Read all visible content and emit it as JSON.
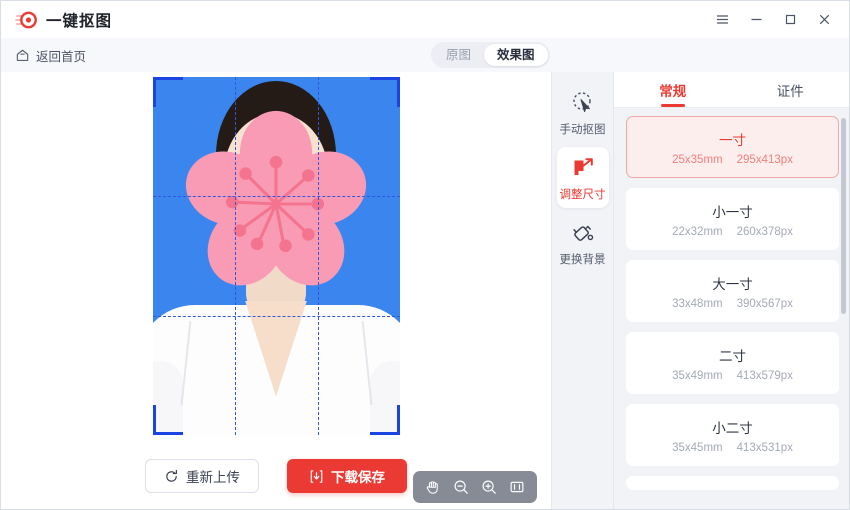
{
  "window": {
    "title": "一键抠图",
    "controls": [
      {
        "name": "menu-button",
        "icon": "hamburger-icon",
        "label": "≡"
      },
      {
        "name": "minimize-button",
        "icon": "minimize-icon",
        "label": "−"
      },
      {
        "name": "maximize-button",
        "icon": "maximize-icon",
        "label": "□"
      },
      {
        "name": "close-button",
        "icon": "close-icon",
        "label": "✕"
      }
    ]
  },
  "toolbar": {
    "home_label": "返回首页",
    "home_icon": "home-icon",
    "view_toggle": {
      "options": [
        {
          "label": "原图",
          "active": false
        },
        {
          "label": "效果图",
          "active": true
        }
      ]
    }
  },
  "canvas": {
    "zoom_toolbar": [
      {
        "name": "pan-tool",
        "icon": "hand-icon"
      },
      {
        "name": "zoom-out-tool",
        "icon": "zoom-out-icon"
      },
      {
        "name": "zoom-in-tool",
        "icon": "zoom-in-icon"
      },
      {
        "name": "fit-screen-tool",
        "icon": "fit-screen-icon"
      }
    ],
    "photo": {
      "background_color": "#3b86ee",
      "overlay": "sakura-blossom-censor",
      "overlay_color": "#f99bb4",
      "crop_guides": "dashed-rule-of-thirds"
    }
  },
  "actions": {
    "reupload_label": "重新上传",
    "reupload_icon": "refresh-icon",
    "download_label": "下载保存",
    "download_icon": "download-icon",
    "primary_color": "#ea3a33"
  },
  "tool_rail": [
    {
      "name": "manual-cutout",
      "label": "手动抠图",
      "icon": "cursor-select-icon",
      "active": false
    },
    {
      "name": "adjust-size",
      "label": "调整尺寸",
      "icon": "resize-icon",
      "active": true
    },
    {
      "name": "change-background",
      "label": "更换背景",
      "icon": "paint-bucket-icon",
      "active": false
    }
  ],
  "right_panel": {
    "tabs": [
      {
        "label": "常规",
        "active": true
      },
      {
        "label": "证件",
        "active": false
      }
    ],
    "sizes": [
      {
        "name": "一寸",
        "mm": "25x35mm",
        "px": "295x413px",
        "selected": true
      },
      {
        "name": "小一寸",
        "mm": "22x32mm",
        "px": "260x378px",
        "selected": false
      },
      {
        "name": "大一寸",
        "mm": "33x48mm",
        "px": "390x567px",
        "selected": false
      },
      {
        "name": "二寸",
        "mm": "35x49mm",
        "px": "413x579px",
        "selected": false
      },
      {
        "name": "小二寸",
        "mm": "35x45mm",
        "px": "413x531px",
        "selected": false
      }
    ]
  }
}
